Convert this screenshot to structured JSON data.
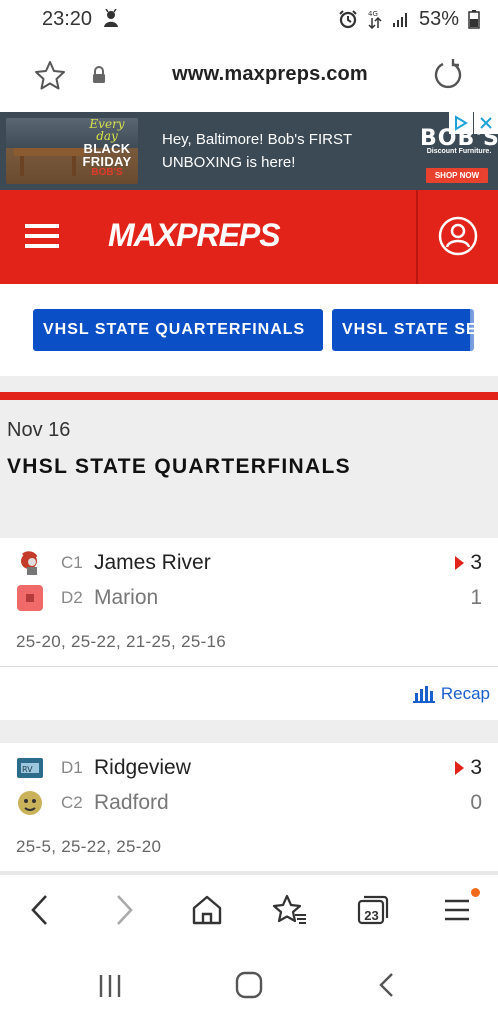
{
  "status_bar": {
    "time": "23:20",
    "battery": "53%",
    "icons": [
      "notification-icon",
      "alarm-icon",
      "data-transfer-icon",
      "signal-icon",
      "battery-icon"
    ]
  },
  "browser": {
    "url": "www.maxpreps.com",
    "tab_count": "23",
    "icons": [
      "star-icon",
      "lock-icon",
      "reload-icon",
      "back-icon",
      "forward-icon",
      "home-icon",
      "bookmarks-icon",
      "tabs-icon",
      "menu-icon"
    ]
  },
  "ad": {
    "promo_line1": "Every day",
    "promo_line2": "BLACK",
    "promo_line3": "FRIDAY",
    "promo_line4": "BOB'S",
    "text": "Hey, Baltimore! Bob's FIRST UNBOXING is here!",
    "brand": "BOB'S",
    "brand_sub": "Discount Furniture.",
    "cta": "SHOP NOW"
  },
  "header": {
    "logo_text": "MAXPREPS",
    "accent_color": "#e2231a"
  },
  "chips": [
    {
      "label": "VHSL STATE QUARTERFINALS"
    },
    {
      "label": "VHSL STATE SEMIFINALS"
    }
  ],
  "section": {
    "date": "Nov 16",
    "title": "VHSL STATE QUARTERFINALS"
  },
  "games": [
    {
      "teams": [
        {
          "seed": "C1",
          "name": "James River",
          "score": "3",
          "winner": true
        },
        {
          "seed": "D2",
          "name": "Marion",
          "score": "1",
          "winner": false
        }
      ],
      "sets": "25-20, 25-22, 21-25, 25-16",
      "recap_label": "Recap"
    },
    {
      "teams": [
        {
          "seed": "D1",
          "name": "Ridgeview",
          "score": "3",
          "winner": true
        },
        {
          "seed": "C2",
          "name": "Radford",
          "score": "0",
          "winner": false
        }
      ],
      "sets": "25-5, 25-22, 25-20"
    }
  ]
}
